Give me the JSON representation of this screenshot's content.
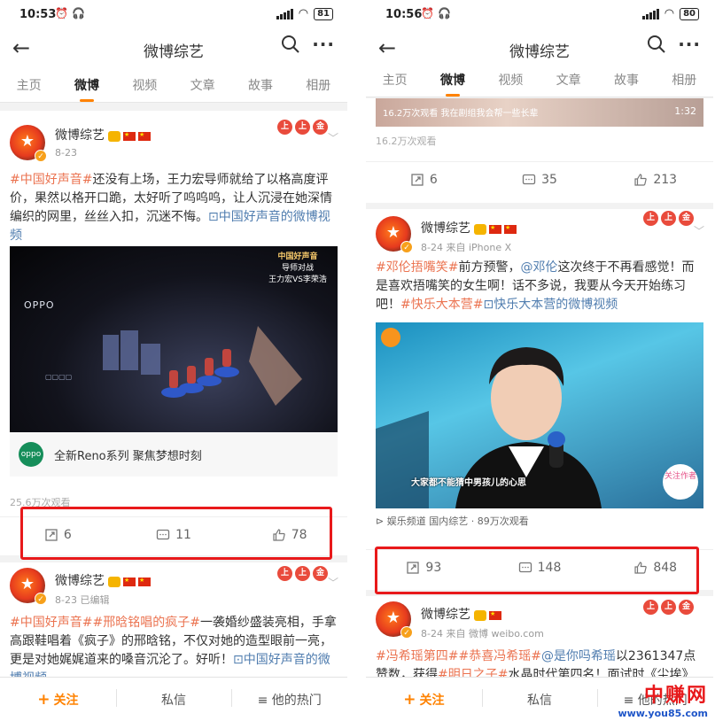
{
  "left": {
    "status": {
      "time": "10:53",
      "battery": "81"
    },
    "header": {
      "back": "←",
      "title": "微博综艺",
      "more": "···"
    },
    "tabs": [
      "主页",
      "微博",
      "视频",
      "文章",
      "故事",
      "相册"
    ],
    "post1": {
      "user": "微博综艺",
      "avatar_text": "微博综艺",
      "meta": "8-23",
      "text_tag": "#中国好声音#",
      "text_body": "还没有上场，王力宏导师就给了以格高度评价，果然以格开口跪，太好听了呜呜呜，让人沉浸在她深情编织的网里，丝丝入扣，沉迷不悔。",
      "text_link": "中国好声音的微博视频",
      "video_logo": "OPPO",
      "video_side_a": "中国好声音",
      "video_side_b": "导师对战",
      "video_side_c": "王力宏VS李荣浩",
      "ad_logo": "oppo",
      "ad_text": "全新Reno系列 聚焦梦想时刻",
      "views": "25.6万次观看",
      "actions": {
        "repost": "6",
        "comment": "11",
        "like": "78"
      }
    },
    "post2": {
      "user": "微博综艺",
      "meta": "8-23  已编辑",
      "text_tag1": "#中国好声音#",
      "text_tag2": "#邢晗铭唱的疯子#",
      "text_body": "一袭婚纱盛装亮相，手拿高跟鞋唱着《疯子》的邢晗铭，不仅对她的造型眼前一亮，更是对她娓娓道来的嗓音沉沦了。好听！",
      "text_link": "中国好声音的微博视频"
    },
    "bottom": {
      "follow": "关注",
      "message": "私信",
      "hot": "他的热门"
    }
  },
  "right": {
    "status": {
      "time": "10:56",
      "battery": "80"
    },
    "header": {
      "back": "←",
      "title": "微博综艺",
      "more": "···"
    },
    "tabs": [
      "主页",
      "微博",
      "视频",
      "文章",
      "故事",
      "相册"
    ],
    "prev": {
      "video_caption": "16.2万次观看  我在剧组我会帮一些长辈",
      "duration": "1:32",
      "views": "16.2万次观看",
      "actions": {
        "repost": "6",
        "comment": "35",
        "like": "213"
      }
    },
    "post1": {
      "user": "微博综艺",
      "meta": "8-24  来自 iPhone X",
      "text_tag1": "#邓伦捂嘴笑#",
      "text_body1": "前方预警，",
      "text_mention": "@邓伦",
      "text_body2": "这次终于不再看感觉！而是喜欢捂嘴笑的女生啊！话不多说，我要从今天开始练习吧！",
      "text_tag2": "#快乐大本营#",
      "text_link": "快乐大本营的微博视频",
      "video_subtitle": "大家都不能猜中男孩儿的心思",
      "follow_badge": "关注作者",
      "source": "娱乐频道 国内综艺 · 89万次观看",
      "actions": {
        "repost": "93",
        "comment": "148",
        "like": "848"
      }
    },
    "post2": {
      "user": "微博综艺",
      "meta": "8-24  来自 微博 weibo.com",
      "text_tag1": "#冯希瑶第四#",
      "text_tag2": "#恭喜冯希瑶#",
      "text_mention": "@是你吗希瑶",
      "text_body": "以2361347点赞数，获得",
      "text_tag3": "#明日之子#",
      "text_body2": "水晶时代第四名！面试时《尘埃》一"
    },
    "bottom": {
      "follow": "关注",
      "message": "私信",
      "hot": "他的热门"
    }
  },
  "watermark": {
    "brand": "中赚网",
    "url": "www.you85.com"
  }
}
